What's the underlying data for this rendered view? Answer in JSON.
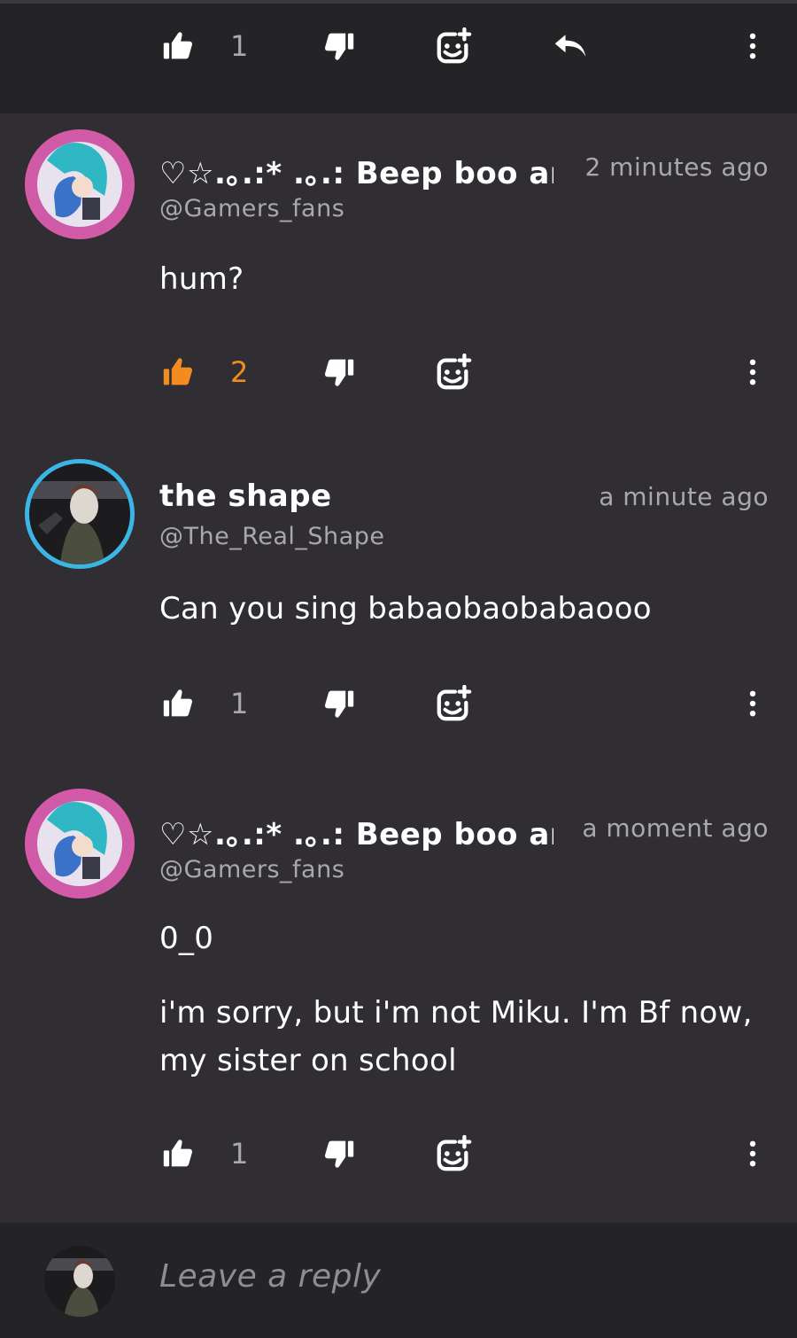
{
  "top_actions": {
    "like_count": "1"
  },
  "comments": [
    {
      "name": "♡☆.｡.:* .｡.: Beep boo and",
      "handle": "@Gamers_fans",
      "time": "2 minutes ago",
      "body_lines": [
        "hum?"
      ],
      "like_count": "2",
      "liked": true
    },
    {
      "name": "the shape",
      "handle": "@The_Real_Shape",
      "time": "a minute ago",
      "body_lines": [
        "Can you sing babaobaobabaooo"
      ],
      "like_count": "1",
      "liked": false
    },
    {
      "name": "♡☆.｡.:* .｡.: Beep boo and",
      "handle": "@Gamers_fans",
      "time": "a moment ago",
      "body_lines": [
        "0_0",
        "i'm sorry, but i'm not Miku. I'm Bf now, my sister on school"
      ],
      "like_count": "1",
      "liked": false
    }
  ],
  "reply": {
    "placeholder": "Leave a reply"
  },
  "colors": {
    "accent": "#f28c1e",
    "muted": "#a9a8ad",
    "background": "#302e33",
    "bar": "#242326"
  },
  "icons": [
    "thumbs-up-icon",
    "thumbs-down-icon",
    "add-reaction-icon",
    "reply-arrow-icon",
    "more-vertical-icon"
  ]
}
